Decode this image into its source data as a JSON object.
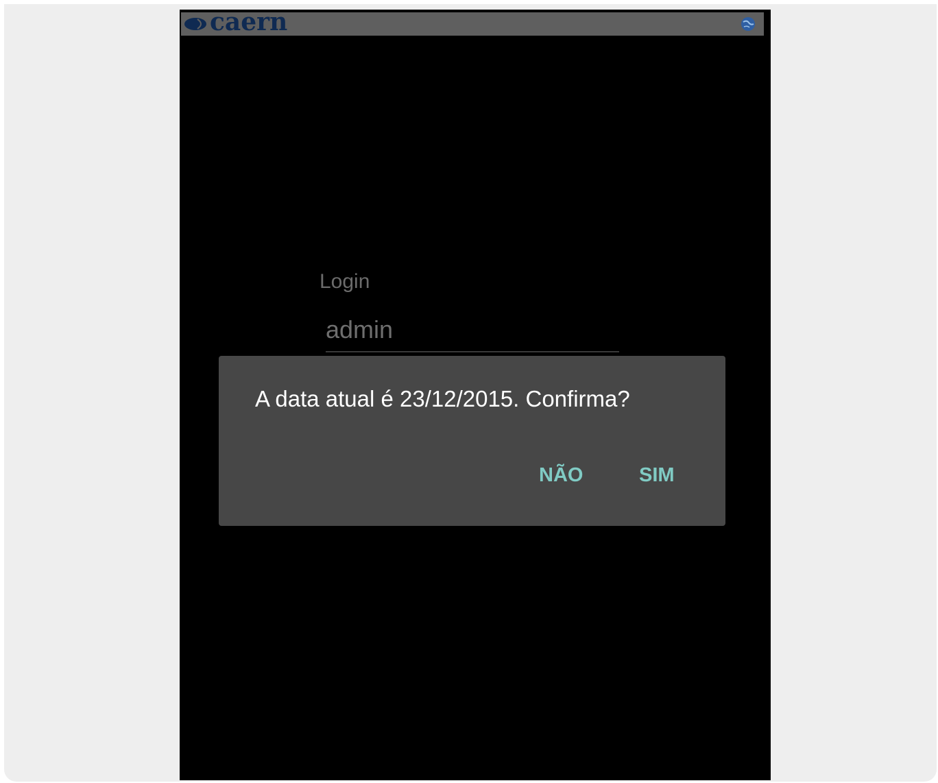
{
  "app_bar": {
    "logo_text": "caern",
    "globe_icon": "globe-icon",
    "background": "#5f5f5f",
    "logo_color": "#0f2a52"
  },
  "login": {
    "label": "Login",
    "value": "admin"
  },
  "dialog": {
    "message": "A data atual é 23/12/2015. Confirma?",
    "negative_label": "NÃO",
    "positive_label": "SIM",
    "accent": "#80cbc4",
    "background": "#474747"
  }
}
